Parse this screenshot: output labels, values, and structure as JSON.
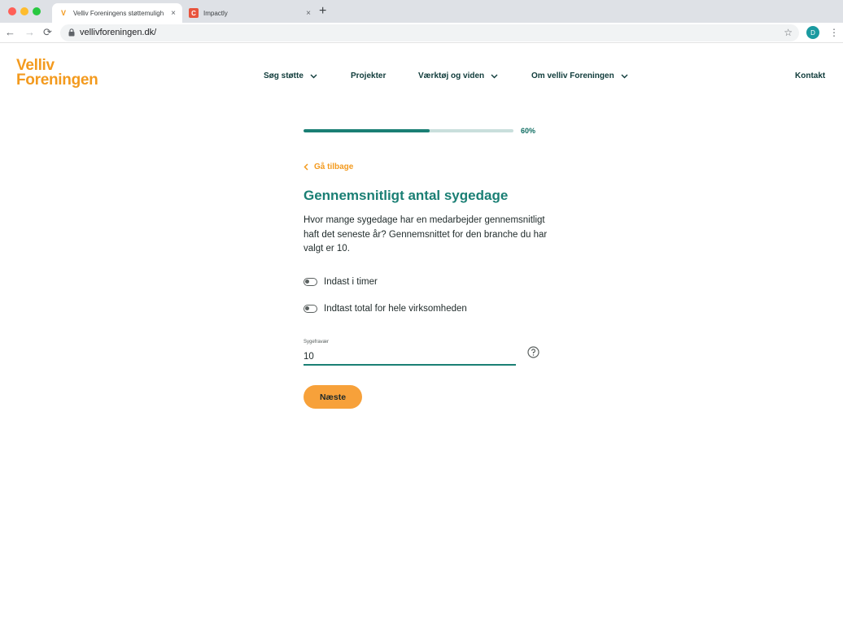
{
  "browser": {
    "tabs": [
      {
        "title": "Velliv Foreningens støttemuligh",
        "favicon": "velliv-v-icon",
        "close": "×"
      },
      {
        "title": "Impactly",
        "favicon": "impactly-icon",
        "close": "×"
      }
    ],
    "new_tab": "+",
    "url": "vellivforeningen.dk/",
    "profile_initial": "D",
    "nav": {
      "back": "←",
      "forward": "→",
      "reload": "⟳"
    },
    "star": "☆",
    "menu": "⋮"
  },
  "site": {
    "logo": {
      "line1": "Velliv",
      "line2": "Foreningen"
    },
    "nav": [
      {
        "label": "Søg støtte",
        "has_dropdown": true
      },
      {
        "label": "Projekter",
        "has_dropdown": false
      },
      {
        "label": "Værktøj og viden",
        "has_dropdown": true
      },
      {
        "label": "Om velliv Foreningen",
        "has_dropdown": true
      },
      {
        "label": "Kontakt",
        "has_dropdown": false
      }
    ]
  },
  "wizard": {
    "progress_percent": 60,
    "progress_label": "60%",
    "back_label": "Gå tilbage",
    "title": "Gennemsnitligt antal sygedage",
    "description": "Hvor mange sygedage har en medarbejder gennemsnitligt haft det seneste år? Gennemsnittet for den branche du har valgt er 10.",
    "toggles": [
      {
        "label": "Indast i timer",
        "on": false
      },
      {
        "label": "Indtast total for hele virksomheden",
        "on": false
      }
    ],
    "field": {
      "label": "Sygefravær",
      "value": "10"
    },
    "next_label": "Næste"
  },
  "colors": {
    "brand_orange": "#f39a1e",
    "brand_teal": "#1a7f74",
    "nav_text": "#0f3b3a",
    "button_orange": "#f7a13a"
  }
}
